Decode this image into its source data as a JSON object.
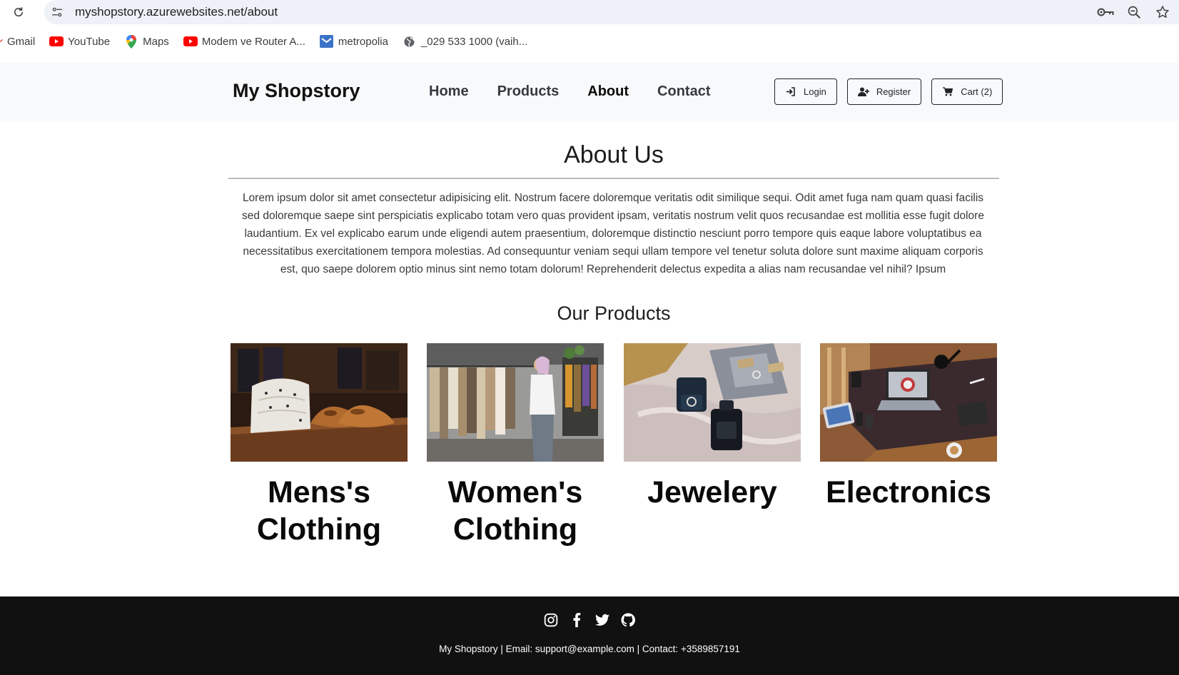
{
  "browser": {
    "url": "myshopstory.azurewebsites.net/about",
    "bookmarks": [
      "Gmail",
      "YouTube",
      "Maps",
      "Modem ve Router A...",
      "metropolia",
      "_029 533 1000 (vaih..."
    ]
  },
  "navbar": {
    "brand": "My Shopstory",
    "links": [
      {
        "label": "Home",
        "active": false
      },
      {
        "label": "Products",
        "active": false
      },
      {
        "label": "About",
        "active": true
      },
      {
        "label": "Contact",
        "active": false
      }
    ],
    "buttons": {
      "login": "Login",
      "register": "Register",
      "cart": "Cart (2)"
    }
  },
  "main": {
    "title": "About Us",
    "paragraph": "Lorem ipsum dolor sit amet consectetur adipisicing elit. Nostrum facere doloremque veritatis odit similique sequi. Odit amet fuga nam quam quasi facilis sed doloremque saepe sint perspiciatis explicabo totam vero quas provident ipsam, veritatis nostrum velit quos recusandae est mollitia esse fugit dolore laudantium. Ex vel explicabo earum unde eligendi autem praesentium, doloremque distinctio nesciunt porro tempore quis eaque labore voluptatibus ea necessitatibus exercitationem tempora molestias. Ad consequuntur veniam sequi ullam tempore vel tenetur soluta dolore sunt maxime aliquam corporis est, quo saepe dolorem optio minus sint nemo totam dolorum! Reprehenderit delectus expedita a alias nam recusandae vel nihil? Ipsum",
    "products_title": "Our Products",
    "categories": [
      {
        "name": "Mens's Clothing",
        "image": "shirts-and-shoes-photo"
      },
      {
        "name": "Women's Clothing",
        "image": "clothing-rack-photo"
      },
      {
        "name": "Jewelery",
        "image": "jewelry-box-photo"
      },
      {
        "name": "Electronics",
        "image": "desk-electronics-photo"
      }
    ]
  },
  "footer": {
    "social_icons": [
      "instagram-icon",
      "facebook-icon",
      "twitter-icon",
      "github-icon"
    ],
    "text": "My Shopstory | Email: support@example.com | Contact: +3589857191"
  }
}
